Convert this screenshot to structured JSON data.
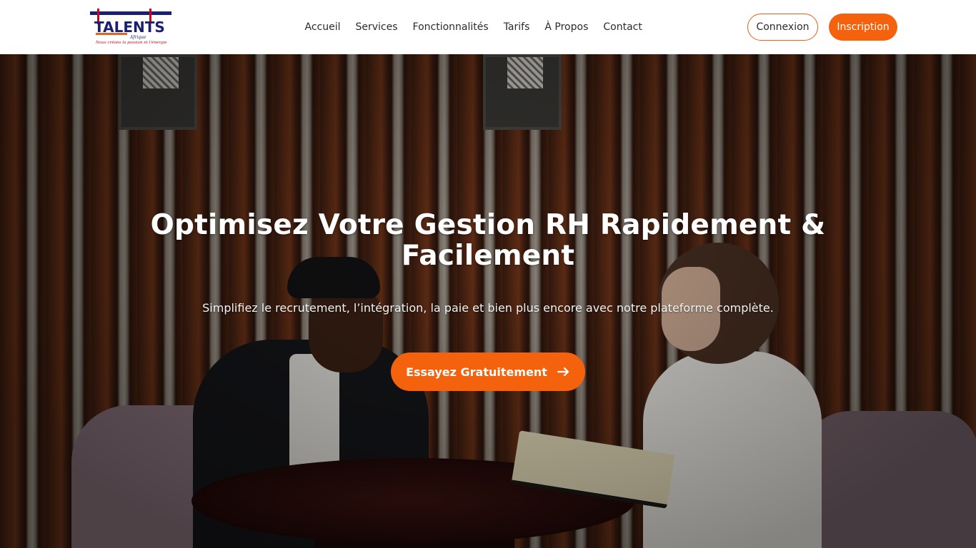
{
  "brand": {
    "logo_text": "TALENTS",
    "logo_subtext": "Afrique",
    "logo_tagline": "Nous créons la passion et l'énergie",
    "colors": {
      "navy": "#1a1f6e",
      "red": "#d0021b",
      "orange": "#f4620d"
    }
  },
  "nav": {
    "items": [
      {
        "label": "Accueil"
      },
      {
        "label": "Services"
      },
      {
        "label": "Fonctionnalités"
      },
      {
        "label": "Tarifs"
      },
      {
        "label": "À Propos"
      },
      {
        "label": "Contact"
      }
    ]
  },
  "auth": {
    "login_label": "Connexion",
    "signup_label": "Inscription"
  },
  "hero": {
    "title": "Optimisez Votre Gestion RH Rapidement & Facilement",
    "subtitle": "Simplifiez le recrutement, l’intégration, la paie et bien plus encore avec notre plateforme complète.",
    "cta_label": "Essayez Gratuitement",
    "cta_icon": "arrow-right-icon",
    "background_image": "photo-two-people-meeting-at-table"
  },
  "theme": {
    "accent": "#f4620d",
    "text_dark": "#2b2b2b",
    "header_bg": "#ffffff"
  }
}
